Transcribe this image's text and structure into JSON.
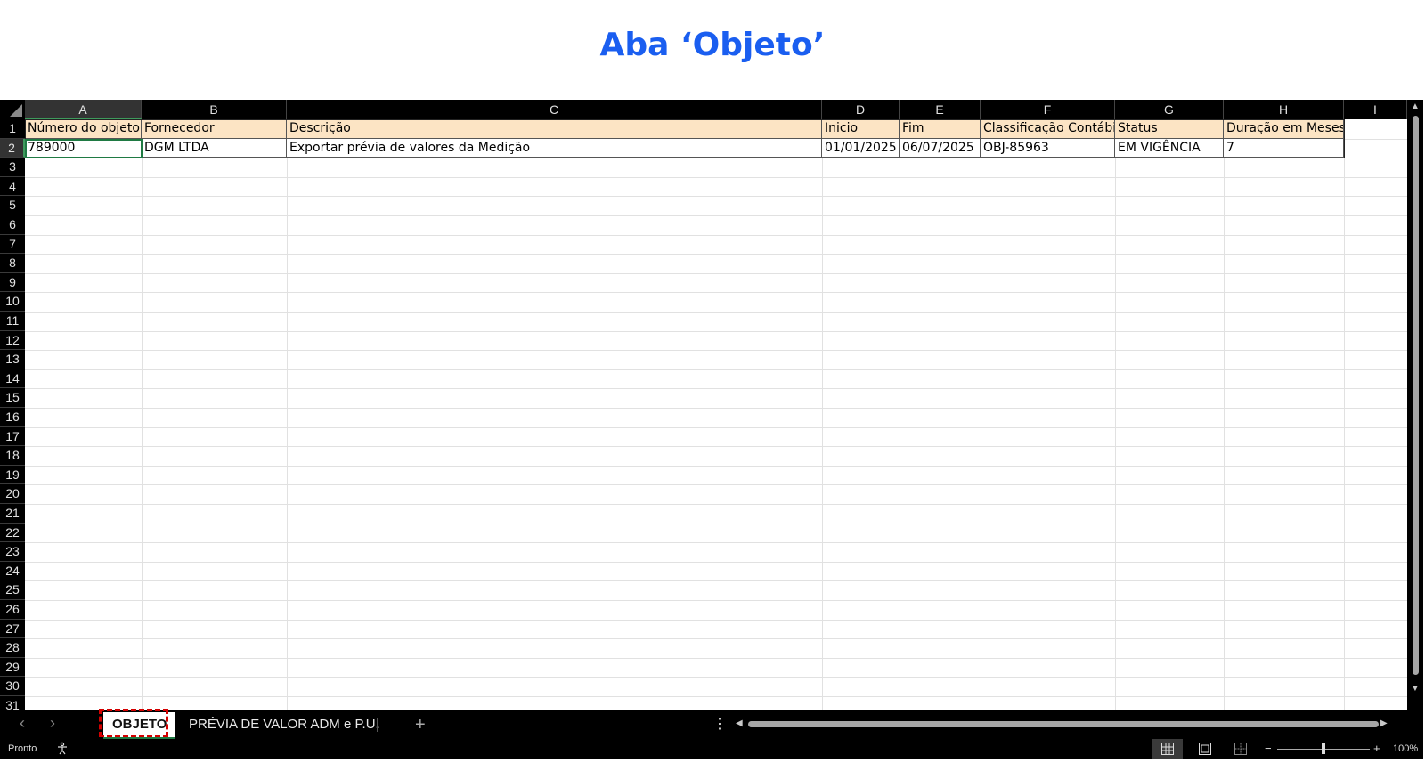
{
  "page_title": "Aba ‘Objeto’",
  "columns": [
    "A",
    "B",
    "C",
    "D",
    "E",
    "F",
    "G",
    "H",
    "I"
  ],
  "row_numbers": [
    "1",
    "2",
    "3",
    "4",
    "5",
    "6",
    "7",
    "8",
    "9",
    "10",
    "11",
    "12",
    "13",
    "14",
    "15",
    "16",
    "17",
    "18",
    "19",
    "20",
    "21",
    "22",
    "23",
    "24",
    "25",
    "26",
    "27",
    "28",
    "29",
    "30",
    "31"
  ],
  "header_row": [
    "Número do objeto",
    "Fornecedor",
    "Descrição",
    "Inicio",
    "Fim",
    "Classificação Contábil",
    "Status",
    "Duração em Meses"
  ],
  "data_row": [
    "789000",
    "DGM LTDA",
    "Exportar prévia de valores da Medição",
    "01/01/2025",
    "06/07/2025",
    "OBJ-85963",
    "EM VIGÊNCIA",
    "7"
  ],
  "selected_cell": "A2",
  "header_fill_color": "#fce4c4",
  "highlight_color": "#d40000",
  "tabs": {
    "prev_icon": "chevron-left-icon",
    "next_icon": "chevron-right-icon",
    "sheets": [
      "OBJETO",
      "PRÉVIA DE VALOR ADM e P.U."
    ],
    "active_sheet": "OBJETO",
    "add_label": "+",
    "more_label": "⋮"
  },
  "status": {
    "ready": "Pronto",
    "accessibility_icon": "accessibility-icon",
    "view_normal_icon": "grid-view-icon",
    "view_page_layout_icon": "page-layout-icon",
    "view_page_break_icon": "page-break-icon",
    "zoom_minus": "−",
    "zoom_plus": "+",
    "zoom_level": "100%"
  }
}
